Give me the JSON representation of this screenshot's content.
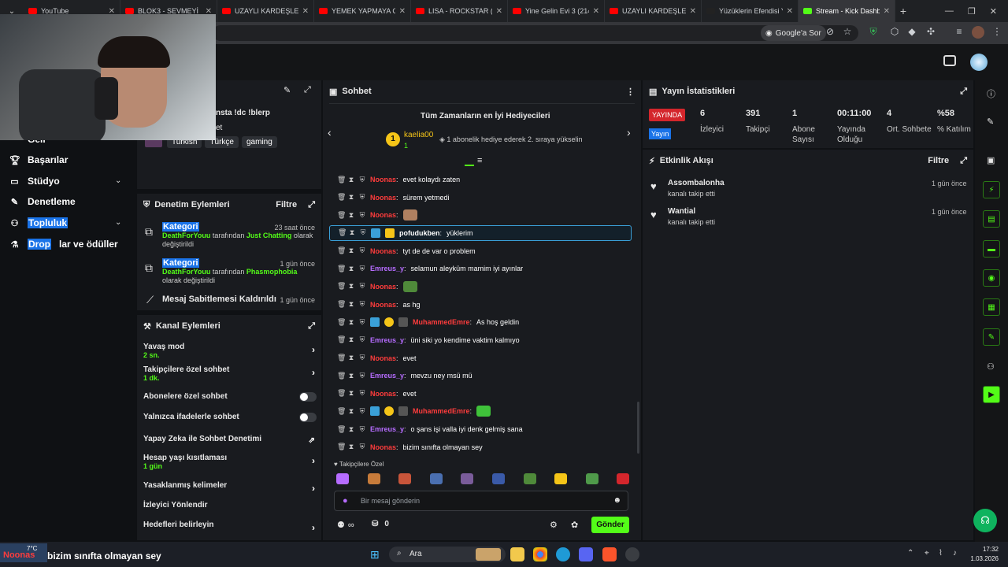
{
  "browser": {
    "tabs": [
      {
        "label": "YouTube",
        "color": "#ff0000"
      },
      {
        "label": "BLOK3 - SEVMEYİ",
        "color": "#ff0000"
      },
      {
        "label": "UZAYLI KARDEŞLER",
        "color": "#ff0000"
      },
      {
        "label": "YEMEK YAPMAYA GEL",
        "color": "#ff0000"
      },
      {
        "label": "LISA - ROCKSTAR (O",
        "color": "#ff0000"
      },
      {
        "label": "Yine Gelin Evi 3 (214",
        "color": "#ff0000"
      },
      {
        "label": "UZAYLI KARDEŞLER",
        "color": "#ff0000"
      },
      {
        "label": "Yüzüklerin Efendisi Y",
        "color": "#222222"
      },
      {
        "label": "Stream - Kick Dashb",
        "color": "#53fc18"
      }
    ],
    "google_sor": "Google'a Sor"
  },
  "stream_info": {
    "title": "nsta !dc !blerp",
    "line2": "et",
    "tags": [
      "Turkish",
      "Türkçe",
      "gaming"
    ]
  },
  "nav": {
    "partial": "Geli",
    "items": [
      {
        "label": "Başarılar",
        "icon": "trophy-icon"
      },
      {
        "label": "Stüdyo",
        "icon": "studio-icon"
      },
      {
        "label": "Denetleme",
        "icon": "wrench-icon"
      },
      {
        "label": "Topluluk",
        "icon": "community-icon"
      },
      {
        "label": "Drop",
        "suffix": "lar ve ödüller",
        "icon": "drops-icon"
      }
    ]
  },
  "mod_actions": {
    "title": "Denetim Eylemleri",
    "filter": "Filtre",
    "items": [
      {
        "title": "Kategori",
        "actor": "DeathForYouu",
        "mid": " tarafından ",
        "target": "Just Chatting",
        "tail": " olarak değiştirildi",
        "time": "23 saat önce"
      },
      {
        "title": "Kategori",
        "actor": "DeathForYouu",
        "mid": " tarafından ",
        "target": "Phasmophobia",
        "tail": " olarak değiştirildi",
        "time": "1 gün önce"
      },
      {
        "title": "Mesaj Sabitlemesi Kaldırıldı",
        "time": "1 gün önce"
      }
    ]
  },
  "channel_actions": {
    "title": "Kanal Eylemleri",
    "settings": [
      {
        "label": "Yavaş mod",
        "value": "2 sn.",
        "kind": "arrow"
      },
      {
        "label": "Takipçilere özel sohbet",
        "value": "1 dk.",
        "kind": "arrow"
      },
      {
        "label": "Abonelere özel sohbet",
        "kind": "toggle"
      },
      {
        "label": "Yalnızca ifadelerle sohbet",
        "kind": "toggle"
      },
      {
        "label": "Yapay Zeka ile Sohbet Denetimi",
        "kind": "external"
      },
      {
        "label": "Hesap yaşı kısıtlaması",
        "value": "1 gün",
        "kind": "arrow"
      },
      {
        "label": "Yasaklanmış kelimeler",
        "kind": "arrow"
      },
      {
        "label": "İzleyici Yönlendir",
        "kind": "none"
      },
      {
        "label": "Hedefleri belirleyin",
        "kind": "arrow"
      }
    ]
  },
  "chat": {
    "title": "Sohbet",
    "gifters_title": "Tüm Zamanların en İyi Hediyecileri",
    "top_gifter": "kaelia00",
    "rank": "1",
    "gifter_count": "1",
    "gifter_hint": "1 abonelik hediye ederek 2. sıraya yükselin",
    "messages": [
      {
        "user": "Noonas",
        "color": "red",
        "text": "evet kolaydı zaten"
      },
      {
        "user": "Noonas",
        "color": "red",
        "text": "sürem yetmedi"
      },
      {
        "user": "Noonas",
        "color": "red",
        "text": "",
        "emote": "#b08060"
      },
      {
        "user": "pofudukben",
        "color": "white",
        "text": "yüklerim",
        "highlight": true
      },
      {
        "user": "Noonas",
        "color": "red",
        "text": "tyt de de var o problem"
      },
      {
        "user": "Emreus_y",
        "color": "purple",
        "text": "selamun aleyküm mamim iyi ayınlar"
      },
      {
        "user": "Noonas",
        "color": "red",
        "text": "",
        "emote": "#4f8a3a"
      },
      {
        "user": "Noonas",
        "color": "red",
        "text": "as hg"
      },
      {
        "user": "MuhammedEmre",
        "color": "red",
        "text": "As hoş geldin",
        "badges": true
      },
      {
        "user": "Emreus_y",
        "color": "purple",
        "text": "üni siki yo kendime vaktim kalmıyo"
      },
      {
        "user": "Noonas",
        "color": "red",
        "text": "evet"
      },
      {
        "user": "Emreus_y",
        "color": "purple",
        "text": "mevzu ney msü mü"
      },
      {
        "user": "Noonas",
        "color": "red",
        "text": "evet"
      },
      {
        "user": "MuhammedEmre",
        "color": "red",
        "text": "",
        "badges": true,
        "emote": "#3fc23a"
      },
      {
        "user": "Emreus_y",
        "color": "purple",
        "text": "o şans işi valla iyi denk gelmiş sana"
      },
      {
        "user": "Noonas",
        "color": "red",
        "text": "bizim sınıfta olmayan sey"
      }
    ],
    "followers_only_label": "Takipçilere Özel",
    "input_placeholder": "Bir mesaj gönderin",
    "infinity": "∞",
    "points": "0",
    "send": "Gönder"
  },
  "stats": {
    "title": "Yayın İstatistikleri",
    "live_badge": "YAYINDA",
    "live_badge2": "Yayın",
    "items": [
      {
        "value": "6",
        "label": "İzleyici"
      },
      {
        "value": "391",
        "label": "Takipçi"
      },
      {
        "value": "1",
        "label": "Abone Sayısı"
      },
      {
        "value": "00:11:00",
        "label": "Yayında Olduğu"
      },
      {
        "value": "4",
        "label": "Ort. Sohbete"
      },
      {
        "value": "%58",
        "label": "% Katılım"
      }
    ]
  },
  "activity": {
    "title": "Etkinlik Akışı",
    "filter": "Filtre",
    "items": [
      {
        "user": "Assombalonha",
        "text": "kanalı takip etti",
        "time": "1 gün önce"
      },
      {
        "user": "Wantial",
        "text": "kanalı takip etti",
        "time": "1 gün önce"
      }
    ]
  },
  "overlay_caption": "bizim sınıfta olmayan sey",
  "overlay_user": "Noonas",
  "taskbar": {
    "weather": "7°C",
    "search": "Ara",
    "time": "17:32",
    "date": "1.03.2026"
  }
}
